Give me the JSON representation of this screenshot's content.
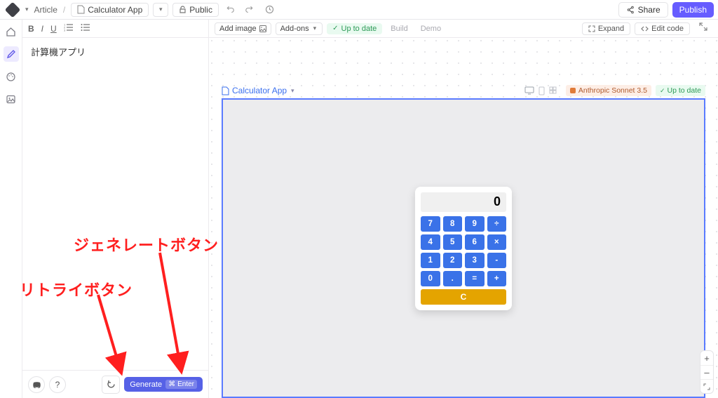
{
  "top": {
    "crumb1": "Article",
    "file": "Calculator App",
    "visibility": "Public",
    "share": "Share",
    "publish": "Publish"
  },
  "toolbar": {
    "add_image": "Add image",
    "addons": "Add-ons",
    "up_to_date": "Up to date",
    "build": "Build",
    "demo": "Demo",
    "expand": "Expand",
    "edit_code": "Edit code"
  },
  "editor": {
    "text": "計算機アプリ",
    "generate": "Generate",
    "generate_shortcut1": "⌘",
    "generate_shortcut2": "Enter",
    "help": "?"
  },
  "artboard": {
    "name": "Calculator App",
    "model": "Anthropic Sonnet 3.5",
    "status": "Up to date"
  },
  "calc": {
    "display": "0",
    "keys": [
      "7",
      "8",
      "9",
      "÷",
      "4",
      "5",
      "6",
      "×",
      "1",
      "2",
      "3",
      "-",
      "0",
      ".",
      "=",
      "+"
    ],
    "clear": "C"
  },
  "annotations": {
    "generate": "ジェネレートボタン",
    "retry": "リトライボタン"
  },
  "zoom": {
    "in": "+",
    "out": "–"
  }
}
